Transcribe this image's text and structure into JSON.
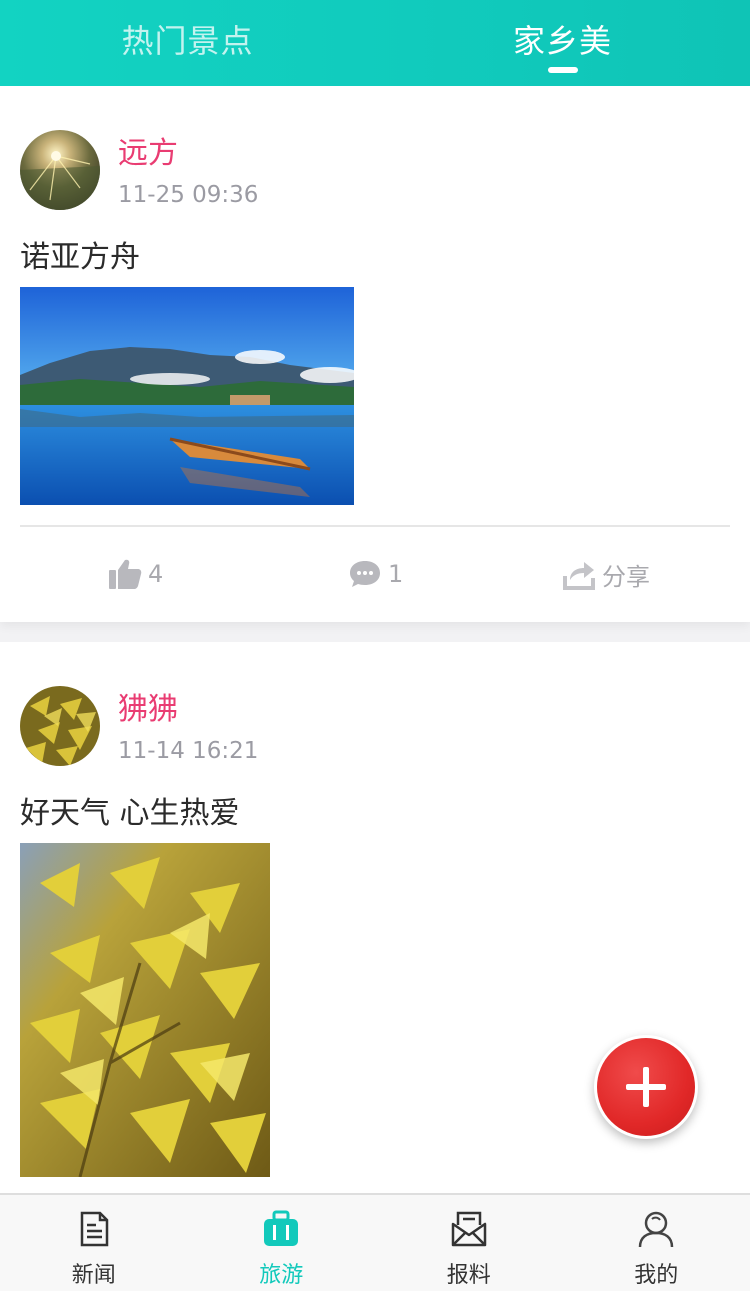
{
  "top_tabs": [
    {
      "label": "热门景点",
      "active": false
    },
    {
      "label": "家乡美",
      "active": true
    }
  ],
  "posts": [
    {
      "author": "远方",
      "time": "11-25 09:36",
      "text": "诺亚方舟",
      "photo": "lake-mountain-boat-photo",
      "likes": "4",
      "comments": "1",
      "share_label": "分享"
    },
    {
      "author": "狒狒",
      "time": "11-14 16:21",
      "text": "好天气 心生热爱",
      "photo": "ginkgo-leaves-photo"
    }
  ],
  "bottom_nav": [
    {
      "label": "新闻",
      "icon": "document-icon",
      "active": false
    },
    {
      "label": "旅游",
      "icon": "suitcase-icon",
      "active": true
    },
    {
      "label": "报料",
      "icon": "mail-icon",
      "active": false
    },
    {
      "label": "我的",
      "icon": "user-icon",
      "active": false
    }
  ],
  "colors": {
    "accent": "#12c9bb",
    "author": "#e93c72",
    "fab": "#e12828"
  }
}
